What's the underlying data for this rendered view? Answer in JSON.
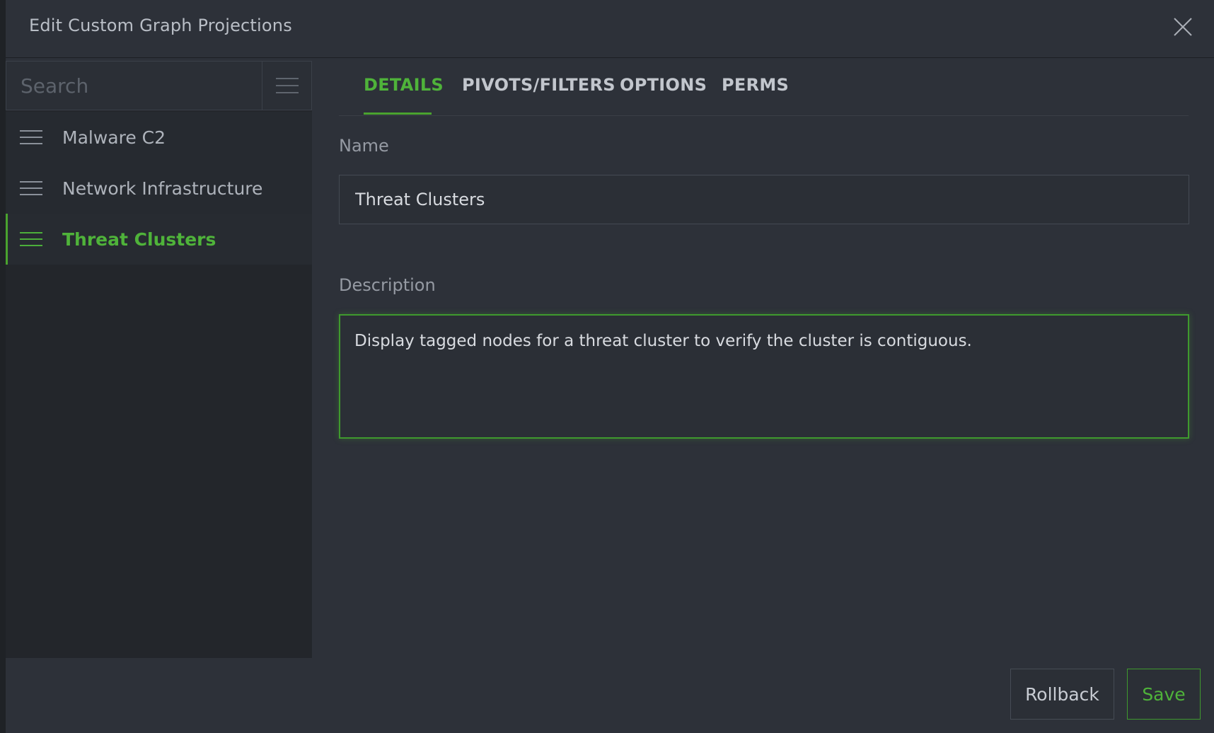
{
  "dialog": {
    "title": "Edit Custom Graph Projections"
  },
  "sidebar": {
    "search_placeholder": "Search",
    "items": [
      {
        "label": "Malware C2",
        "active": false
      },
      {
        "label": "Network Infrastructure",
        "active": false
      },
      {
        "label": "Threat Clusters",
        "active": true
      }
    ]
  },
  "tabs": [
    {
      "label": "DETAILS",
      "active": true
    },
    {
      "label": "PIVOTS/FILTERS",
      "active": false
    },
    {
      "label": "OPTIONS",
      "active": false
    },
    {
      "label": "PERMS",
      "active": false
    }
  ],
  "form": {
    "name_label": "Name",
    "name_value": "Threat Clusters",
    "description_label": "Description",
    "description_value": "Display tagged nodes for a threat cluster to verify the cluster is contiguous."
  },
  "footer": {
    "rollback_label": "Rollback",
    "save_label": "Save"
  },
  "colors": {
    "accent": "#4fb33a",
    "background": "#2d3139",
    "sidebar": "#23262b"
  }
}
